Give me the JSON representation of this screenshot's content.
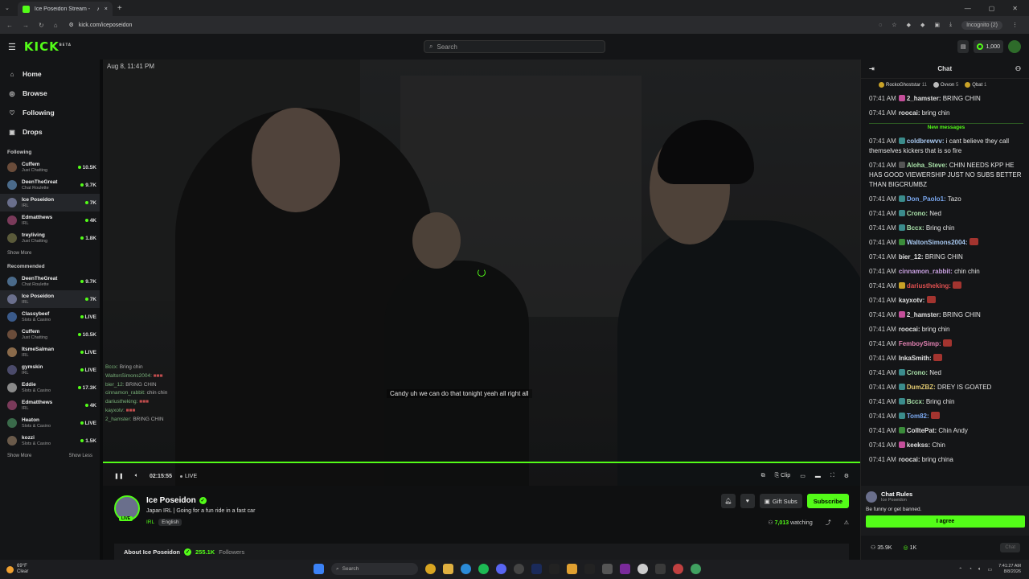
{
  "browser": {
    "tab_title": "Ice Poseidon Stream - Watch...",
    "url": "kick.com/iceposeidon",
    "incognito_label": "Incognito (2)"
  },
  "header": {
    "logo": "KICK",
    "logo_sup": "BETA",
    "search_placeholder": "Search",
    "kicks_amount": "1,000"
  },
  "sidebar": {
    "nav": [
      {
        "label": "Home",
        "icon": "home-icon"
      },
      {
        "label": "Browse",
        "icon": "compass-icon"
      },
      {
        "label": "Following",
        "icon": "heart-icon"
      },
      {
        "label": "Drops",
        "icon": "gift-icon"
      }
    ],
    "following_title": "Following",
    "following": [
      {
        "name": "Cuffem",
        "category": "Just Chatting",
        "viewers": "10.5K",
        "live": false,
        "avatar": "#6a4c3a"
      },
      {
        "name": "DeenTheGreat",
        "category": "Chat Roulette",
        "viewers": "9.7K",
        "live": false,
        "avatar": "#4a6a8a"
      },
      {
        "name": "Ice Poseidon",
        "category": "IRL",
        "viewers": "7K",
        "live": false,
        "active": true,
        "avatar": "#6a6f8c"
      },
      {
        "name": "Edmatthews",
        "category": "IRL",
        "viewers": "4K",
        "live": false,
        "avatar": "#7a3a5a"
      },
      {
        "name": "treyliving",
        "category": "Just Chatting",
        "viewers": "1.8K",
        "live": false,
        "avatar": "#5a5a3a"
      }
    ],
    "following_show_more": "Show More",
    "recommended_title": "Recommended",
    "recommended": [
      {
        "name": "DeenTheGreat",
        "category": "Chat Roulette",
        "viewers": "9.7K",
        "avatar": "#4a6a8a"
      },
      {
        "name": "Ice Poseidon",
        "category": "IRL",
        "viewers": "7K",
        "active": true,
        "avatar": "#6a6f8c"
      },
      {
        "name": "Classybeef",
        "category": "Slots & Casino",
        "viewers": "LIVE",
        "avatar": "#3a5a8a"
      },
      {
        "name": "Cuffem",
        "category": "Just Chatting",
        "viewers": "10.5K",
        "avatar": "#6a4c3a"
      },
      {
        "name": "ItsmeSalman",
        "category": "IRL",
        "viewers": "LIVE",
        "avatar": "#8a6a4a"
      },
      {
        "name": "gymskin",
        "category": "IRL",
        "viewers": "LIVE",
        "avatar": "#4a4a6a"
      },
      {
        "name": "Eddie",
        "category": "Slots & Casino",
        "viewers": "17.3K",
        "avatar": "#8a8a8a"
      },
      {
        "name": "Edmatthews",
        "category": "IRL",
        "viewers": "4K",
        "avatar": "#7a3a5a"
      },
      {
        "name": "Heaton",
        "category": "Slots & Casino",
        "viewers": "LIVE",
        "avatar": "#3a6a4a"
      },
      {
        "name": "kozzi",
        "category": "Slots & Casino",
        "viewers": "1.5K",
        "avatar": "#6a5a4a"
      }
    ],
    "show_more": "Show More",
    "show_less": "Show Less"
  },
  "video": {
    "date": "Aug 8, 11:41 PM",
    "caption": "Candy uh we can do that tonight yeah all right all",
    "overlay_chat": [
      {
        "user": "Bccx:",
        "text": "Bring chin"
      },
      {
        "user": "WaltonSimons2004:",
        "text": ""
      },
      {
        "user": "bier_12:",
        "text": "BRING CHIN"
      },
      {
        "user": "cinnamon_rabbit:",
        "text": "chin chin"
      },
      {
        "user": "dariustheking:",
        "text": ""
      },
      {
        "user": "kayxotv:",
        "text": ""
      },
      {
        "user": "2_hamster:",
        "text": "BRING CHIN"
      }
    ],
    "time": "02:15:55",
    "live_label": "LIVE",
    "clip_label": "Clip"
  },
  "stream": {
    "streamer": "Ice Poseidon",
    "live_badge": "LIVE",
    "title": "Japan IRL | Going for a fun ride in a fast car",
    "category": "IRL",
    "language": "English",
    "gift_subs": "Gift Subs",
    "subscribe": "Subscribe",
    "watching_count": "7,013",
    "watching_label": "watching",
    "about_label": "About Ice Poseidon",
    "followers_count": "255.1K",
    "followers_label": "Followers"
  },
  "chat": {
    "title": "Chat",
    "pinned": [
      {
        "name": "RockoGhoststar",
        "count": "11",
        "color": "#c9a227"
      },
      {
        "name": "Ovvon",
        "count": "5",
        "color": "#bbbbbb"
      },
      {
        "name": "Qbat",
        "count": "1",
        "color": "#c9a227"
      }
    ],
    "new_messages_label": "New messages",
    "messages": [
      {
        "ts": "07:41 AM",
        "user": "2_hamster:",
        "text": "BRING CHIN",
        "color": "#e0e0e0",
        "badge": "#c44f9a"
      },
      {
        "ts": "07:41 AM",
        "user": "roocai:",
        "text": "bring chin",
        "color": "#e0e0e0",
        "badge": ""
      },
      {
        "divider": true
      },
      {
        "ts": "07:41 AM",
        "user": "coldbrewvv:",
        "text": "i cant believe they call themselves kickers that is so fire",
        "color": "#a8c8f0",
        "badge": "#3b8c8c"
      },
      {
        "ts": "07:41 AM",
        "user": "Aloha_Steve:",
        "text": "CHIN NEEDS KPP HE HAS GOOD VIEWERSHIP JUST NO SUBS BETTER THAN BIGCRUMBZ",
        "color": "#a8e0a8",
        "badge": "#555555"
      },
      {
        "ts": "07:41 AM",
        "user": "Don_Paolo1:",
        "text": "Tazo",
        "color": "#7aa8f0",
        "badge": "#3b8c8c"
      },
      {
        "ts": "07:41 AM",
        "user": "Crono:",
        "text": "Ned",
        "color": "#a8e0a8",
        "badge": "#3b8c8c"
      },
      {
        "ts": "07:41 AM",
        "user": "Bccx:",
        "text": "Bring chin",
        "color": "#a8e0a8",
        "badge": "#3b8c8c"
      },
      {
        "ts": "07:41 AM",
        "user": "WaltonSimons2004:",
        "text": "",
        "color": "#a8c8f0",
        "badge": "#3b8c3b"
      },
      {
        "ts": "07:41 AM",
        "user": "bier_12:",
        "text": "BRING CHIN",
        "color": "#e0e0e0",
        "badge": ""
      },
      {
        "ts": "07:41 AM",
        "user": "cinnamon_rabbit:",
        "text": "chin chin",
        "color": "#c8a0e0",
        "badge": ""
      },
      {
        "ts": "07:41 AM",
        "user": "dariustheking:",
        "text": "",
        "color": "#e05050",
        "badge": "#c9a227"
      },
      {
        "ts": "07:41 AM",
        "user": "kayxotv:",
        "text": "",
        "color": "#e0e0e0",
        "badge": ""
      },
      {
        "ts": "07:41 AM",
        "user": "2_hamster:",
        "text": "BRING CHIN",
        "color": "#e0e0e0",
        "badge": "#c44f9a"
      },
      {
        "ts": "07:41 AM",
        "user": "roocai:",
        "text": "bring chin",
        "color": "#e0e0e0",
        "badge": ""
      },
      {
        "ts": "07:41 AM",
        "user": "FemboySimp:",
        "text": "",
        "color": "#e080b0",
        "badge": ""
      },
      {
        "ts": "07:41 AM",
        "user": "InkaSmith:",
        "text": "",
        "color": "#e0e0e0",
        "badge": ""
      },
      {
        "ts": "07:41 AM",
        "user": "Crono:",
        "text": "Ned",
        "color": "#a8e0a8",
        "badge": "#3b8c8c"
      },
      {
        "ts": "07:41 AM",
        "user": "DumZBZ:",
        "text": "DREY IS GOATED",
        "color": "#e0c870",
        "badge": "#3b8c8c"
      },
      {
        "ts": "07:41 AM",
        "user": "Bccx:",
        "text": "Bring chin",
        "color": "#a8e0a8",
        "badge": "#3b8c8c"
      },
      {
        "ts": "07:41 AM",
        "user": "Tom82:",
        "text": "",
        "color": "#7aa8f0",
        "badge": "#3b8c8c"
      },
      {
        "ts": "07:41 AM",
        "user": "ColltePat:",
        "text": "Chin Andy",
        "color": "#e0e0e0",
        "badge": "#3b8c3b"
      },
      {
        "ts": "07:41 AM",
        "user": "keekss:",
        "text": "Chin",
        "color": "#e0e0e0",
        "badge": "#c44f9a"
      },
      {
        "ts": "07:41 AM",
        "user": "roocai:",
        "text": "bring china",
        "color": "#e0e0e0",
        "badge": ""
      }
    ],
    "rules_title": "Chat Rules",
    "rules_sub": "Ice Poseidon",
    "rules_body": "Be funny or get banned.",
    "agree_label": "I agree",
    "foot_followers": "35.9K",
    "foot_kicks": "1K",
    "chat_button": "Chat"
  },
  "taskbar": {
    "temp": "69°F",
    "weather": "Clear",
    "search_placeholder": "Search",
    "time": "7:41:27 AM",
    "date": "8/8/2026"
  }
}
